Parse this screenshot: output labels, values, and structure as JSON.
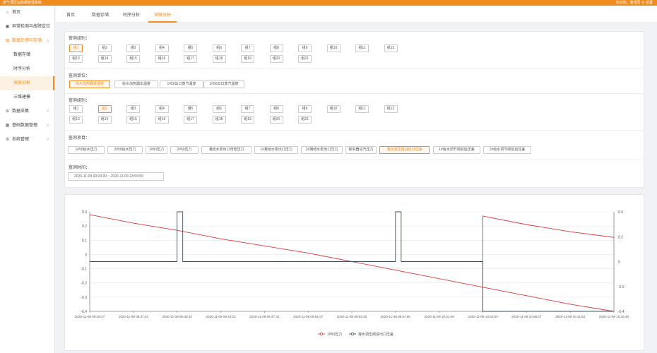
{
  "header": {
    "brand": "燃气调压站数据管理系统",
    "user": "欢迎您，管理员  ⚙ 设置"
  },
  "sidebar": {
    "items": [
      {
        "icon": "⌂",
        "icon_name": "home-icon",
        "label": "首页"
      },
      {
        "icon": "▣",
        "icon_name": "alarm-locate-icon",
        "label": "异常检测与故障定位"
      },
      {
        "icon": "▤",
        "icon_name": "data-process-icon",
        "label": "数据处理与存储",
        "arrow": "˄",
        "active": true,
        "children": [
          {
            "label": "数据存储"
          },
          {
            "label": "时序分析"
          },
          {
            "label": "关联分析",
            "active": true
          },
          {
            "label": "三维建模"
          }
        ]
      },
      {
        "icon": "⊛",
        "icon_name": "data-collect-icon",
        "label": "数据采集",
        "arrow": "˅"
      },
      {
        "icon": "▦",
        "icon_name": "basic-data-icon",
        "label": "基础数据管理",
        "arrow": "˅"
      },
      {
        "icon": "⚙",
        "icon_name": "system-settings-icon",
        "label": "系统管理",
        "arrow": "˅"
      }
    ]
  },
  "tabs": [
    {
      "label": "首页"
    },
    {
      "label": "数据存储"
    },
    {
      "label": "时序分析"
    },
    {
      "label": "关联分析",
      "active": true
    }
  ],
  "form": {
    "group1_label": "查询组别：",
    "group1_options": [
      "组1",
      "组2",
      "组3",
      "组4",
      "组5",
      "组6",
      "组7",
      "组8",
      "组9",
      "组10",
      "组11",
      "组12",
      "组13",
      "组14",
      "组15",
      "组16",
      "组17",
      "组18",
      "组19",
      "组20",
      "组21"
    ],
    "group1_selected": "组1",
    "unit_label": "查询单位：",
    "unit_options": [
      "给水加热器进温度",
      "给水加热器出温度",
      "1#50出口蒸汽温度",
      "2#50出口蒸汽温度"
    ],
    "unit_selected": "给水加热器进温度",
    "group2_label": "查询组别：",
    "group2_options": [
      "组1",
      "组2",
      "组3",
      "组4",
      "组5",
      "组6",
      "组7",
      "组8",
      "组9",
      "组10",
      "组11",
      "组12",
      "组13",
      "组14",
      "组15",
      "组16",
      "组17",
      "组18",
      "组19",
      "组20",
      "组21"
    ],
    "group2_selected": "组2",
    "item_label": "查询项目：",
    "item_options": [
      "1#50给水压力",
      "2#50给水压力",
      "1#50压力",
      "2#50压力",
      "凝结水泵出口母管压力",
      "1#凝结水泵出口压力",
      "2#凝结水泵出口压力",
      "除氧器进汽压力",
      "凝水调压阀进出口压差",
      "1#给水调节阀前后压差",
      "2#给水调节阀前后压差"
    ],
    "item_selected": "凝水调压阀进出口压差",
    "time_label": "查询时间：",
    "time_value": "2020-11-09 00:00:00 ~ 2020-11-09 23:59:59"
  },
  "chart_data": {
    "type": "line",
    "x": [
      "2020-11-09 09:29:27",
      "2020-11-09 09:37:24",
      "2020-11-09 09:40:34",
      "2020-11-09 09:44:22",
      "2020-11-09 09:47:42",
      "2020-11-09 09:51:07",
      "2020-11-09 09:54:26",
      "2020-11-09 09:57:50",
      "2020-11-09 10:01:09",
      "2020-11-09 10:04:53",
      "2020-11-09 10:08:27",
      "2020-11-09 10:11:54",
      "2020-11-09 10:16:40"
    ],
    "y_left_ticks": [
      "0.3",
      "0.2",
      "0.1",
      "0",
      "-0.1",
      "-0.2",
      "-0.3",
      "-0.4"
    ],
    "y_left_range": [
      -0.4,
      0.3
    ],
    "y_right_ticks": [
      "0.4",
      "0.2",
      "0",
      "-0.2",
      "-0.4"
    ],
    "y_right_range": [
      -0.4,
      0.4
    ],
    "series": [
      {
        "name": "1#50压力",
        "axis": "left",
        "color": "#d9383a",
        "values": [
          0.28,
          0.22,
          0.17,
          0.11,
          0.06,
          0.01,
          -0.05,
          -0.11,
          -0.17,
          -0.23,
          -0.29,
          -0.35,
          -0.4
        ],
        "after_reset": {
          "x_index": 9,
          "values_from_reset": [
            0.27,
            0.21,
            0.16,
            0.12
          ]
        }
      },
      {
        "name": "凝水调压阀进出口压差",
        "axis": "right",
        "color": "#3d4f5c",
        "baseline": 0,
        "pulses": [
          {
            "start_index": 2,
            "value": 0.4
          },
          {
            "start_index": 7,
            "value": 0.4
          }
        ],
        "drop_at_index": 9,
        "drop_value": -0.4
      }
    ],
    "legend": [
      "1#50压力",
      "凝水调压阀进出口压差"
    ],
    "legend_position": "bottom"
  }
}
